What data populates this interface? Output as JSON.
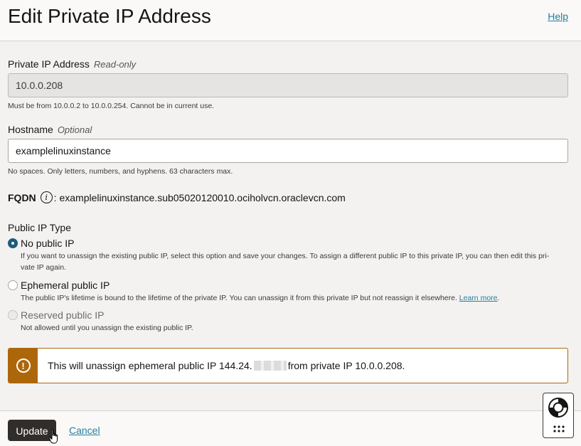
{
  "header": {
    "title": "Edit Private IP Address",
    "help_label": "Help"
  },
  "private_ip": {
    "label": "Private IP Address",
    "hint": "Read-only",
    "value": "10.0.0.208",
    "help_text": "Must be from 10.0.0.2 to 10.0.0.254. Cannot be in current use."
  },
  "hostname": {
    "label": "Hostname",
    "hint": "Optional",
    "value": "examplelinuxinstance",
    "help_text": "No spaces. Only letters, numbers, and hyphens. 63 characters max."
  },
  "fqdn": {
    "label": "FQDN",
    "value": "examplelinuxinstance.sub05020120010.ociholvcn.oraclevcn.com"
  },
  "public_ip_type": {
    "label": "Public IP Type",
    "options": [
      {
        "label": "No public IP",
        "checked": true,
        "description_line1": "If you want to unassign the existing public IP, select this option and save your changes. To assign a different public IP to this private IP, you can then edit this pri-",
        "description_line2": "vate IP again."
      },
      {
        "label": "Ephemeral public IP",
        "checked": false,
        "description": "The public IP's lifetime is bound to the lifetime of the private IP. You can unassign it from this private IP but not reassign it elsewhere.",
        "link": "Learn more",
        "suffix": "."
      },
      {
        "label": "Reserved public IP",
        "checked": false,
        "disabled": true,
        "description": "Not allowed until you unassign the existing public IP."
      }
    ]
  },
  "alert": {
    "text_before": "This will unassign ephemeral public IP 144.24.",
    "text_after": "from private IP 10.0.0.208."
  },
  "footer": {
    "update_label": "Update",
    "cancel_label": "Cancel"
  },
  "colors": {
    "accent": "#1f5c7a",
    "link": "#227e9e",
    "warning": "#ad670b",
    "primary_button": "#312d2a"
  },
  "icons": [
    "info-icon",
    "warning-icon",
    "lifebuoy-icon",
    "grid-dots-icon",
    "pointer-hand-icon"
  ]
}
